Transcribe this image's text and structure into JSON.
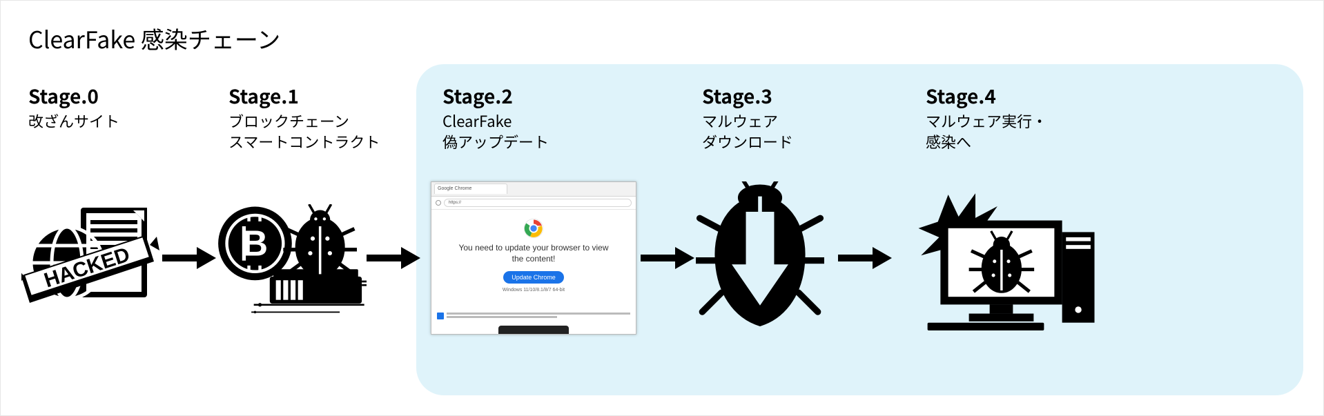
{
  "title": "ClearFake 感染チェーン",
  "stages": [
    {
      "num": "Stage.0",
      "desc": "改ざんサイト"
    },
    {
      "num": "Stage.1",
      "desc": "ブロックチェーン\nスマートコントラクト"
    },
    {
      "num": "Stage.2",
      "desc": "ClearFake\n偽アップデート"
    },
    {
      "num": "Stage.3",
      "desc": "マルウェア\nダウンロード"
    },
    {
      "num": "Stage.4",
      "desc": "マルウェア実行・\n感染へ"
    }
  ],
  "hacked_banner": "HACKED",
  "fake_update": {
    "tab_text": "Google Chrome",
    "headline": "You need to update your browser to view\nthe content!",
    "button": "Update Chrome",
    "subtext": "Windows 11/10/8.1/8/7 64-bit",
    "address_bar": "https://"
  },
  "chart_data": {
    "type": "flow",
    "title": "ClearFake 感染チェーン",
    "nodes": [
      {
        "id": "stage0",
        "label": "Stage.0",
        "desc": "改ざんサイト",
        "icon": "hacked-site"
      },
      {
        "id": "stage1",
        "label": "Stage.1",
        "desc": "ブロックチェーン / スマートコントラクト",
        "icon": "bitcoin-bug-router"
      },
      {
        "id": "stage2",
        "label": "Stage.2",
        "desc": "ClearFake / 偽アップデート",
        "icon": "fake-browser-update",
        "highlighted": true
      },
      {
        "id": "stage3",
        "label": "Stage.3",
        "desc": "マルウェア / ダウンロード",
        "icon": "bug-download",
        "highlighted": true
      },
      {
        "id": "stage4",
        "label": "Stage.4",
        "desc": "マルウェア実行・感染へ",
        "icon": "infected-pc",
        "highlighted": true
      }
    ],
    "edges": [
      {
        "from": "stage0",
        "to": "stage1"
      },
      {
        "from": "stage1",
        "to": "stage2"
      },
      {
        "from": "stage2",
        "to": "stage3"
      },
      {
        "from": "stage3",
        "to": "stage4"
      }
    ],
    "highlight_group": [
      "stage2",
      "stage3",
      "stage4"
    ]
  }
}
